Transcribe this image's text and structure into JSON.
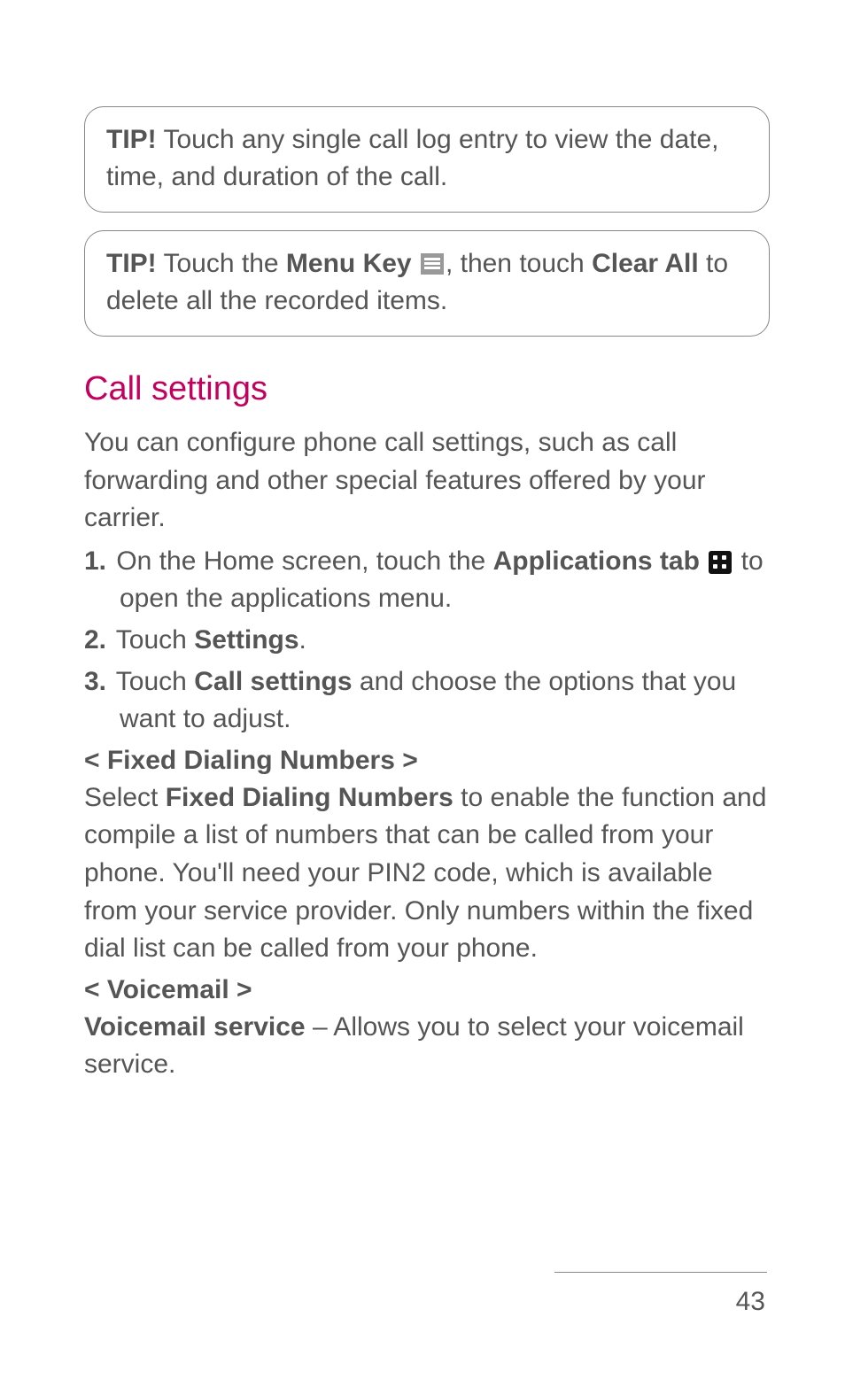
{
  "tipBox1": {
    "tipLabel": "TIP!",
    "text": " Touch any single call log entry to view the date, time, and duration of the call."
  },
  "tipBox2": {
    "tipLabel": "TIP!",
    "part1": " Touch the ",
    "menuKey": "Menu Key ",
    "part2": ", then touch ",
    "clearAll": "Clear All",
    "part3": " to delete all the recorded items."
  },
  "heading": "Call settings",
  "intro": "You can configure phone call settings, such as call forwarding and other special features offered by your carrier.",
  "steps": {
    "s1": {
      "num": "1.",
      "a": " On the Home screen, touch the ",
      "b": "Applications tab",
      "c": " to open the applications menu."
    },
    "s2": {
      "num": "2.",
      "a": " Touch ",
      "b": "Settings",
      "c": "."
    },
    "s3": {
      "num": "3.",
      "a": " Touch ",
      "b": "Call settings",
      "c": " and choose the options that you want to adjust."
    }
  },
  "fdnHeading": "< Fixed Dialing Numbers >",
  "fdn": {
    "a": "Select ",
    "b": "Fixed Dialing Numbers",
    "c": " to enable the function and compile a list of numbers that can be called from your phone. You'll need your PIN2 code, which is available from your service provider. Only numbers within the fixed dial list can be called from your phone."
  },
  "vmHeading": "< Voicemail >",
  "vm": {
    "a": "Voicemail service",
    "b": " – Allows you to select your voicemail service."
  },
  "pageNumber": "43"
}
